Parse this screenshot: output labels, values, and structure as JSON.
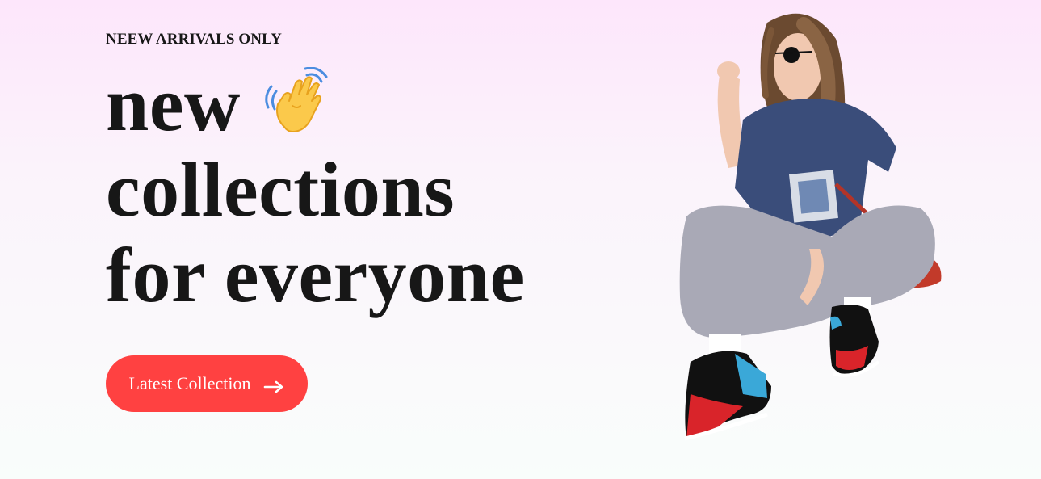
{
  "hero": {
    "eyebrow": "NEEW ARRIVALS ONLY",
    "headline_line1": "new",
    "headline_line2": "collections",
    "headline_line3": "for everyone",
    "cta_label": "Latest Collection",
    "wave_icon": "waving-hand-icon",
    "cta_icon": "arrow-right-icon",
    "image_alt": "hero-model-image"
  },
  "colors": {
    "accent": "#ff4141",
    "text": "#171717",
    "bg_top": "#fde6fb",
    "bg_bottom": "#f9fdfb"
  }
}
